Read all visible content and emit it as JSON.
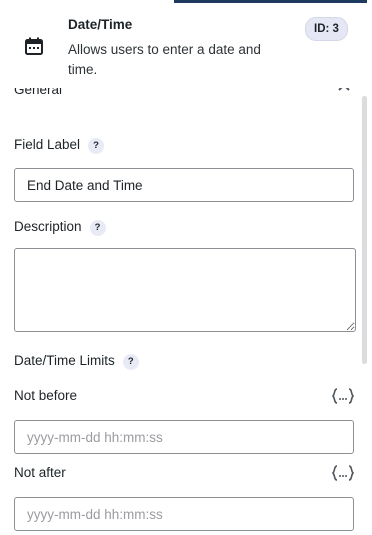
{
  "header": {
    "title": "Date/Time",
    "description": "Allows users to enter a date and time.",
    "id_badge": "ID: 3",
    "icon": "calendar-icon"
  },
  "section": {
    "title": "General",
    "toggle_icon": "chevron-up-icon"
  },
  "field_label": {
    "label": "Field Label",
    "help": "?",
    "value": "End Date and Time"
  },
  "description": {
    "label": "Description",
    "help": "?",
    "value": ""
  },
  "limits": {
    "label": "Date/Time Limits",
    "help": "?",
    "not_before": {
      "label": "Not before",
      "placeholder": "yyyy-mm-dd hh:mm:ss",
      "value": "",
      "icon": "variables-icon"
    },
    "not_after": {
      "label": "Not after",
      "placeholder": "yyyy-mm-dd hh:mm:ss",
      "value": "",
      "icon": "variables-icon"
    }
  },
  "colors": {
    "accent": "#1e3a5f",
    "badge_bg": "#e5e7f5",
    "border": "#8c8f94"
  }
}
